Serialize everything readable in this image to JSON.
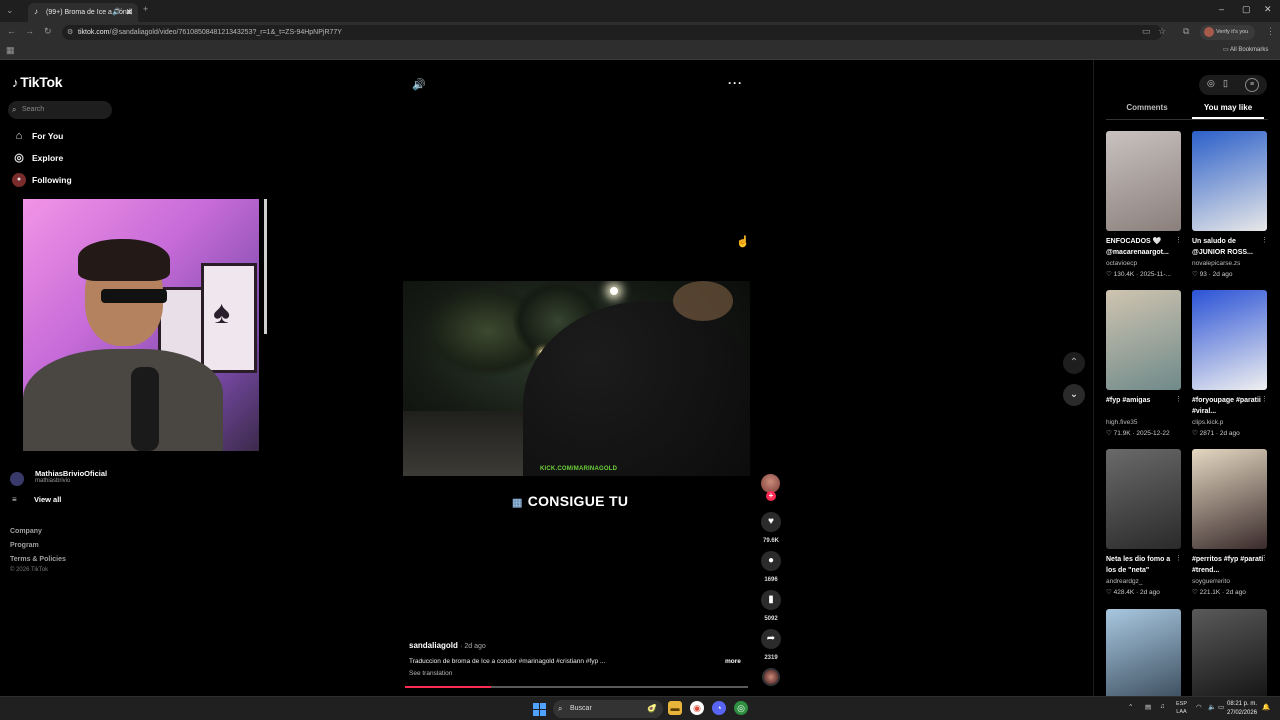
{
  "browser": {
    "tab_title": "(99+) Broma de Ice a Cóndi",
    "address_host": "tiktok.com",
    "address_path": "/@sandaliagold/video/7610850848121343253?_r=1&_t=ZS-94HpNPjR77Y",
    "profile_label": "Verify it's you",
    "bookmarks_label": "All Bookmarks"
  },
  "sidebar": {
    "logo_text": "TikTok",
    "search_placeholder": "Search",
    "nav": [
      {
        "label": "For You",
        "icon": "home-icon"
      },
      {
        "label": "Explore",
        "icon": "compass-icon"
      },
      {
        "label": "Following",
        "icon": "following-avatar-icon"
      }
    ],
    "account": {
      "name": "MathiasBrivioOficial",
      "handle": "mathiasbrivio"
    },
    "view_all": "View all",
    "footer": [
      "Company",
      "Program",
      "Terms & Policies"
    ],
    "copyright": "© 2026 TikTok"
  },
  "player": {
    "watermark": "KICK.COM/MARINAGOLD",
    "caption": "CONSIGUE TU",
    "author": "sandaliagold",
    "date": "· 2d ago",
    "description": "Traduccion de broma de Ice a condor #marinagold #cristiann #fyp ...",
    "more_label": "more",
    "translate_label": "See translation",
    "progress": 0.25,
    "actions": {
      "likes": "79.6K",
      "comments": "1696",
      "saves": "5092",
      "shares": "2319"
    }
  },
  "right_panel": {
    "tabs": {
      "comments": "Comments",
      "you_may_like": "You may like"
    },
    "cards": [
      {
        "title": "ENFOCADOS 🤍 @macarenaargot...",
        "handle": "octavioecp",
        "meta": "♡ 130.4K · 2025-11-...",
        "colors": [
          "#c9c2c0",
          "#8a7f7b"
        ]
      },
      {
        "title": "Un saludo de @JUNIOR ROSS...",
        "handle": "novalepicarse.zs",
        "meta": "♡ 93 · 2d ago",
        "colors": [
          "#2b5fc9",
          "#e8e8e8"
        ]
      },
      {
        "title": "#fyp #amigas",
        "handle": "high.five35",
        "meta": "♡ 71.9K · 2025-12-22",
        "colors": [
          "#cfc4b0",
          "#6f8a8a"
        ]
      },
      {
        "title": "#foryoupage #paratii #viral...",
        "handle": "clips.kick.p",
        "meta": "♡ 2871 · 2d ago",
        "colors": [
          "#2a52d6",
          "#f0f0f0"
        ]
      },
      {
        "title": "Neta les dio fomo a los de \"neta\"",
        "handle": "andreardgz_",
        "meta": "♡ 428.4K · 2d ago",
        "colors": [
          "#6a6a6a",
          "#2a2a2a"
        ]
      },
      {
        "title": "#perritos #fyp #paratí #trend...",
        "handle": "soyguerrerito",
        "meta": "♡ 221.1K · 2d ago",
        "colors": [
          "#e4d8c2",
          "#3a2b2b"
        ]
      },
      {
        "title": "",
        "handle": "",
        "meta": "",
        "colors": [
          "#a9c8e0",
          "#3d4f60"
        ]
      },
      {
        "title": "",
        "handle": "",
        "meta": "",
        "colors": [
          "#5a5a5a",
          "#151515"
        ]
      }
    ]
  },
  "taskbar": {
    "search_label": "Buscar",
    "lang": "ESP",
    "lang_sub": "LAA",
    "time": "08:21 p. m.",
    "date": "27/02/2026"
  }
}
